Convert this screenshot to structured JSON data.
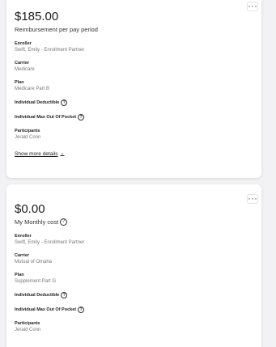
{
  "more_icon_glyph": "···",
  "info_glyph": "?",
  "chevron_glyph": "⌄",
  "cards": [
    {
      "amount": "$185.00",
      "amount_label": "Reimbursement per pay period",
      "enroller_label": "Enroller",
      "enroller_value": "Swift, Emily - Enrollment Partner",
      "carrier_label": "Carrier",
      "carrier_value": "Medicare",
      "plan_label": "Plan",
      "plan_value": "Medicare Part B",
      "deductible_label": "Individual Deductible",
      "max_oop_label": "Individual Max Out Of Pocket",
      "participants_label": "Participants",
      "participants_value": "Jerald Conn",
      "show_more": "Show more details"
    },
    {
      "amount": "$0.00",
      "amount_label": "My Monthly cost",
      "enroller_label": "Enroller",
      "enroller_value": "Swift, Emily - Enrollment Partner",
      "carrier_label": "Carrier",
      "carrier_value": "Mutual of Omaha",
      "plan_label": "Plan",
      "plan_value": "Supplement Part G",
      "deductible_label": "Individual Deductible",
      "max_oop_label": "Individual Max Out Of Pocket",
      "participants_label": "Participants",
      "participants_value": "Jerald Conn"
    }
  ]
}
